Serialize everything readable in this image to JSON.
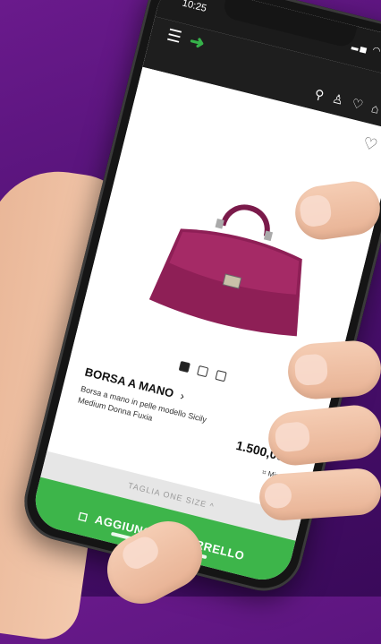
{
  "status_bar": {
    "time": "10:25"
  },
  "header": {
    "menu_icon": "hamburger-icon",
    "arrow_icon": "arrow-right-icon",
    "icons": [
      "search-icon",
      "user-icon",
      "heart-icon",
      "bag-icon"
    ]
  },
  "product": {
    "wishlist_icon": "heart-outline-icon",
    "name": "BORSA A MANO",
    "description": "Borsa a mano in pelle modello Sicily Medium Donna Fuxia",
    "price": "1.500,00 €",
    "size_guide": "Misure",
    "image_pages": 3,
    "active_page": 1,
    "bag_color": "#8e1f56"
  },
  "size_selector": {
    "label": "TAGLIA  ONE SIZE ^"
  },
  "cta": {
    "label": "AGGIUNGI AL CARRELLO",
    "color": "#3db54a"
  },
  "background_color": "#5a1480"
}
